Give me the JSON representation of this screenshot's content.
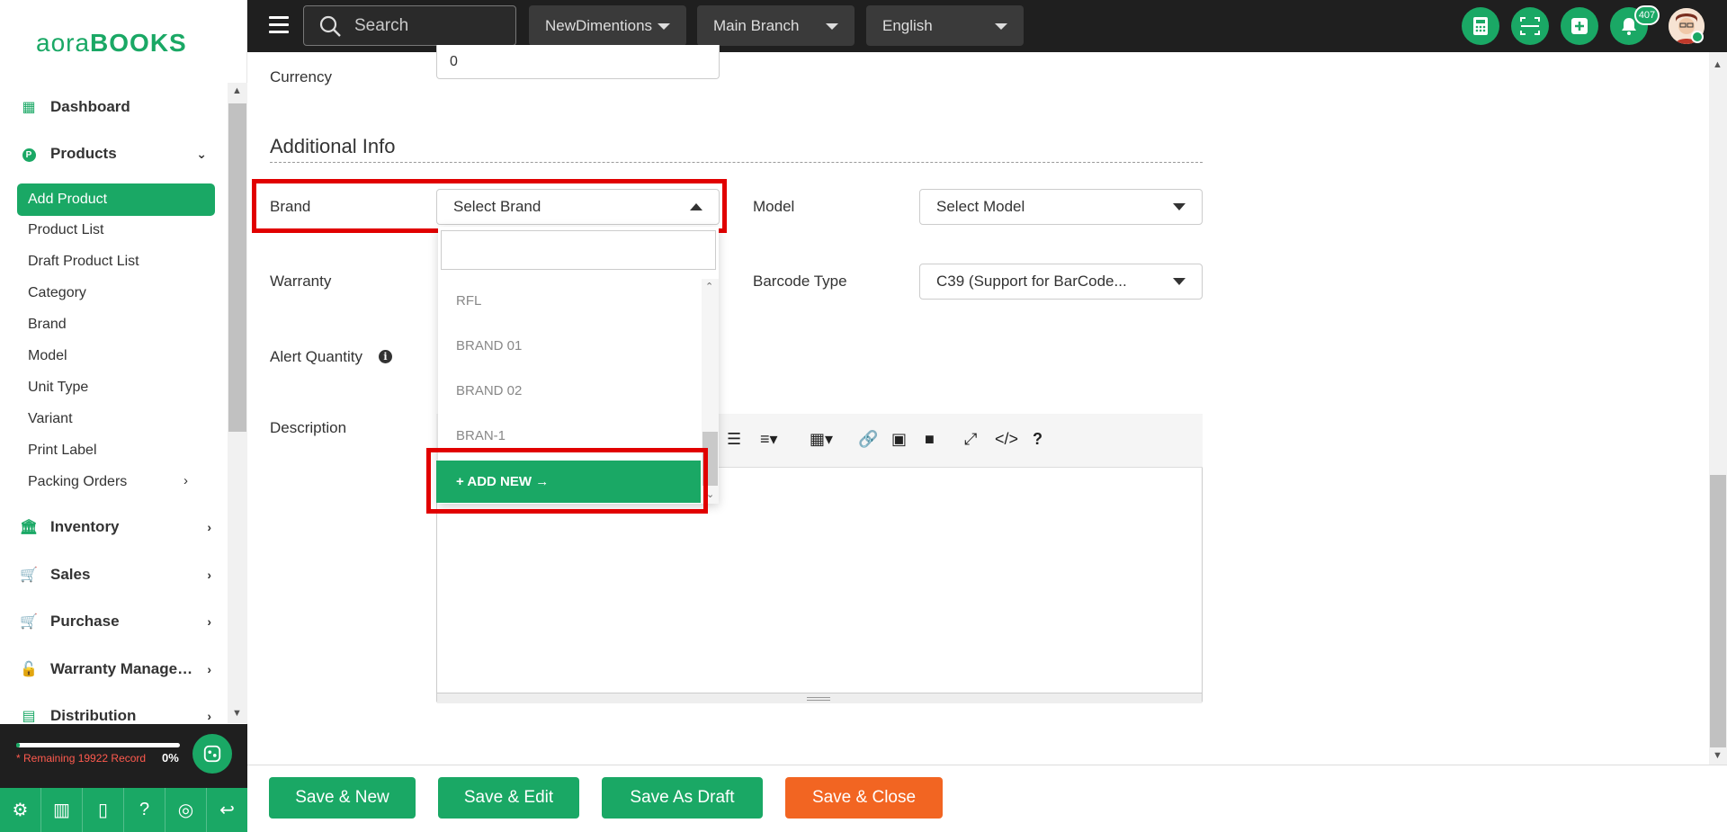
{
  "brand": {
    "logo_part1": "aora",
    "logo_part2": "BOOKS"
  },
  "sidebar": {
    "items": [
      {
        "label": "Dashboard",
        "icon": "grid-icon"
      },
      {
        "label": "Products",
        "icon": "p-circle-icon"
      },
      {
        "label": "Inventory",
        "icon": "bank-icon"
      },
      {
        "label": "Sales",
        "icon": "cart-icon"
      },
      {
        "label": "Purchase",
        "icon": "cart-icon"
      },
      {
        "label": "Warranty Manage…",
        "icon": "lock-icon"
      },
      {
        "label": "Distribution",
        "icon": "file-icon"
      }
    ],
    "sub_items": [
      "Add Product",
      "Product List",
      "Draft Product List",
      "Category",
      "Brand",
      "Model",
      "Unit Type",
      "Variant",
      "Print Label",
      "Packing Orders"
    ],
    "footer": {
      "remaining": "* Remaining 19922 Record",
      "percent": "0%",
      "progress": 0.02
    }
  },
  "topbar": {
    "search_placeholder": "Search",
    "company": "NewDimentions",
    "branch": "Main Branch",
    "language": "English",
    "notification_count": "407"
  },
  "form": {
    "currency_label": "Currency",
    "currency_value": "0",
    "section_title": "Additional Info",
    "brand_label": "Brand",
    "brand_placeholder": "Select Brand",
    "model_label": "Model",
    "model_placeholder": "Select Model",
    "warranty_label": "Warranty",
    "barcode_label": "Barcode Type",
    "barcode_value": "C39 (Support for BarCode...",
    "alert_label": "Alert Quantity",
    "description_label": "Description"
  },
  "brand_dropdown": {
    "options": [
      "RFL",
      "BRAND 01",
      "BRAND 02",
      "BRAN-1"
    ],
    "add_new": "+ ADD NEW →"
  },
  "buttons": {
    "save_new": "Save & New",
    "save_edit": "Save & Edit",
    "save_draft": "Save As Draft",
    "save_close": "Save & Close"
  },
  "colors": {
    "accent": "#1aa865",
    "orange": "#f26522",
    "highlight": "#e10000",
    "topbar": "#1f1f1f"
  }
}
